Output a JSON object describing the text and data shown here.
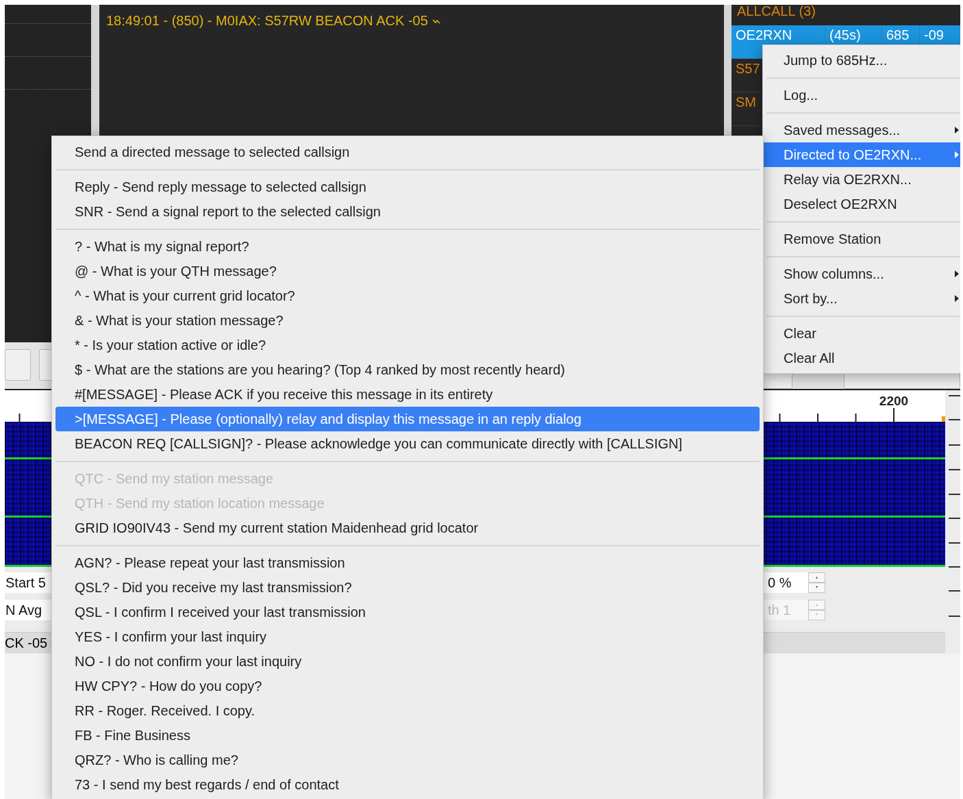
{
  "message_log": {
    "lines": [
      "18:49:01 - (850) - M0IAX: S57RW BEACON ACK -05"
    ]
  },
  "call_activity": {
    "header": "ALLCALL (3)",
    "rows": [
      {
        "cells": [
          "OE2RXN",
          "(45s)",
          "685",
          "-09"
        ],
        "selected": true
      },
      {
        "cells": [
          "S57"
        ],
        "selected": false
      },
      {
        "cells": [
          "SM"
        ],
        "selected": false
      }
    ]
  },
  "waterfall": {
    "tick_label": "2200"
  },
  "controls": {
    "left_fields": [
      {
        "text": "Start 5"
      },
      {
        "text": "N Avg"
      }
    ],
    "spinboxes": [
      {
        "text": "0 %",
        "disabled": false
      },
      {
        "text": "th 1",
        "disabled": true
      }
    ],
    "status_text": "CK -05"
  },
  "station_menu": {
    "items": [
      {
        "kind": "item",
        "label": "Jump to 685Hz...",
        "submenu": false,
        "selected": false
      },
      {
        "kind": "separator"
      },
      {
        "kind": "item",
        "label": "Log...",
        "submenu": false,
        "selected": false
      },
      {
        "kind": "separator"
      },
      {
        "kind": "item",
        "label": "Saved messages...",
        "submenu": true,
        "selected": false
      },
      {
        "kind": "item",
        "label": "Directed to OE2RXN...",
        "submenu": true,
        "selected": true
      },
      {
        "kind": "item",
        "label": "Relay via OE2RXN...",
        "submenu": false,
        "selected": false
      },
      {
        "kind": "item",
        "label": "Deselect OE2RXN",
        "submenu": false,
        "selected": false
      },
      {
        "kind": "separator"
      },
      {
        "kind": "item",
        "label": "Remove Station",
        "submenu": false,
        "selected": false
      },
      {
        "kind": "separator"
      },
      {
        "kind": "item",
        "label": "Show columns...",
        "submenu": true,
        "selected": false
      },
      {
        "kind": "item",
        "label": "Sort by...",
        "submenu": true,
        "selected": false
      },
      {
        "kind": "separator"
      },
      {
        "kind": "item",
        "label": "Clear",
        "submenu": false,
        "selected": false
      },
      {
        "kind": "item",
        "label": "Clear All",
        "submenu": false,
        "selected": false
      }
    ]
  },
  "directed_menu": {
    "items": [
      {
        "kind": "item",
        "label": "Send a directed message to selected callsign",
        "selected": false,
        "disabled": false
      },
      {
        "kind": "separator"
      },
      {
        "kind": "item",
        "label": "Reply - Send reply message to selected callsign",
        "selected": false,
        "disabled": false
      },
      {
        "kind": "item",
        "label": "SNR - Send a signal report to the selected callsign",
        "selected": false,
        "disabled": false
      },
      {
        "kind": "separator"
      },
      {
        "kind": "item",
        "label": "? - What is my signal report?",
        "selected": false,
        "disabled": false
      },
      {
        "kind": "item",
        "label": "@ - What is your QTH message?",
        "selected": false,
        "disabled": false
      },
      {
        "kind": "item",
        "label": "^ - What is your current grid locator?",
        "selected": false,
        "disabled": false
      },
      {
        "kind": "item",
        "label": "& - What is your station message?",
        "selected": false,
        "disabled": false
      },
      {
        "kind": "item",
        "label": "* - Is your station active or idle?",
        "selected": false,
        "disabled": false
      },
      {
        "kind": "item",
        "label": "$ - What are the stations are you hearing? (Top 4 ranked by most recently heard)",
        "selected": false,
        "disabled": false
      },
      {
        "kind": "item",
        "label": "#[MESSAGE] - Please ACK if you receive this message in its entirety",
        "selected": false,
        "disabled": false
      },
      {
        "kind": "item",
        "label": ">[MESSAGE] - Please (optionally) relay and display this message in an reply dialog",
        "selected": true,
        "disabled": false
      },
      {
        "kind": "item",
        "label": "BEACON REQ [CALLSIGN]? - Please acknowledge you can communicate directly with [CALLSIGN]",
        "selected": false,
        "disabled": false
      },
      {
        "kind": "separator"
      },
      {
        "kind": "item",
        "label": "QTC - Send my station message",
        "selected": false,
        "disabled": true
      },
      {
        "kind": "item",
        "label": "QTH - Send my station location message",
        "selected": false,
        "disabled": true
      },
      {
        "kind": "item",
        "label": "GRID IO90IV43 - Send my current station Maidenhead grid locator",
        "selected": false,
        "disabled": false
      },
      {
        "kind": "separator"
      },
      {
        "kind": "item",
        "label": "AGN? - Please repeat your last transmission",
        "selected": false,
        "disabled": false
      },
      {
        "kind": "item",
        "label": "QSL? - Did you receive my last transmission?",
        "selected": false,
        "disabled": false
      },
      {
        "kind": "item",
        "label": "QSL - I confirm I received your last transmission",
        "selected": false,
        "disabled": false
      },
      {
        "kind": "item",
        "label": "YES - I confirm your last inquiry",
        "selected": false,
        "disabled": false
      },
      {
        "kind": "item",
        "label": "NO - I do not confirm your last inquiry",
        "selected": false,
        "disabled": false
      },
      {
        "kind": "item",
        "label": "HW CPY? - How do you copy?",
        "selected": false,
        "disabled": false
      },
      {
        "kind": "item",
        "label": "RR - Roger. Received. I copy.",
        "selected": false,
        "disabled": false
      },
      {
        "kind": "item",
        "label": "FB - Fine Business",
        "selected": false,
        "disabled": false
      },
      {
        "kind": "item",
        "label": "QRZ? - Who is calling me?",
        "selected": false,
        "disabled": false
      },
      {
        "kind": "item",
        "label": "73 - I send my best regards / end of contact",
        "selected": false,
        "disabled": false
      }
    ]
  }
}
